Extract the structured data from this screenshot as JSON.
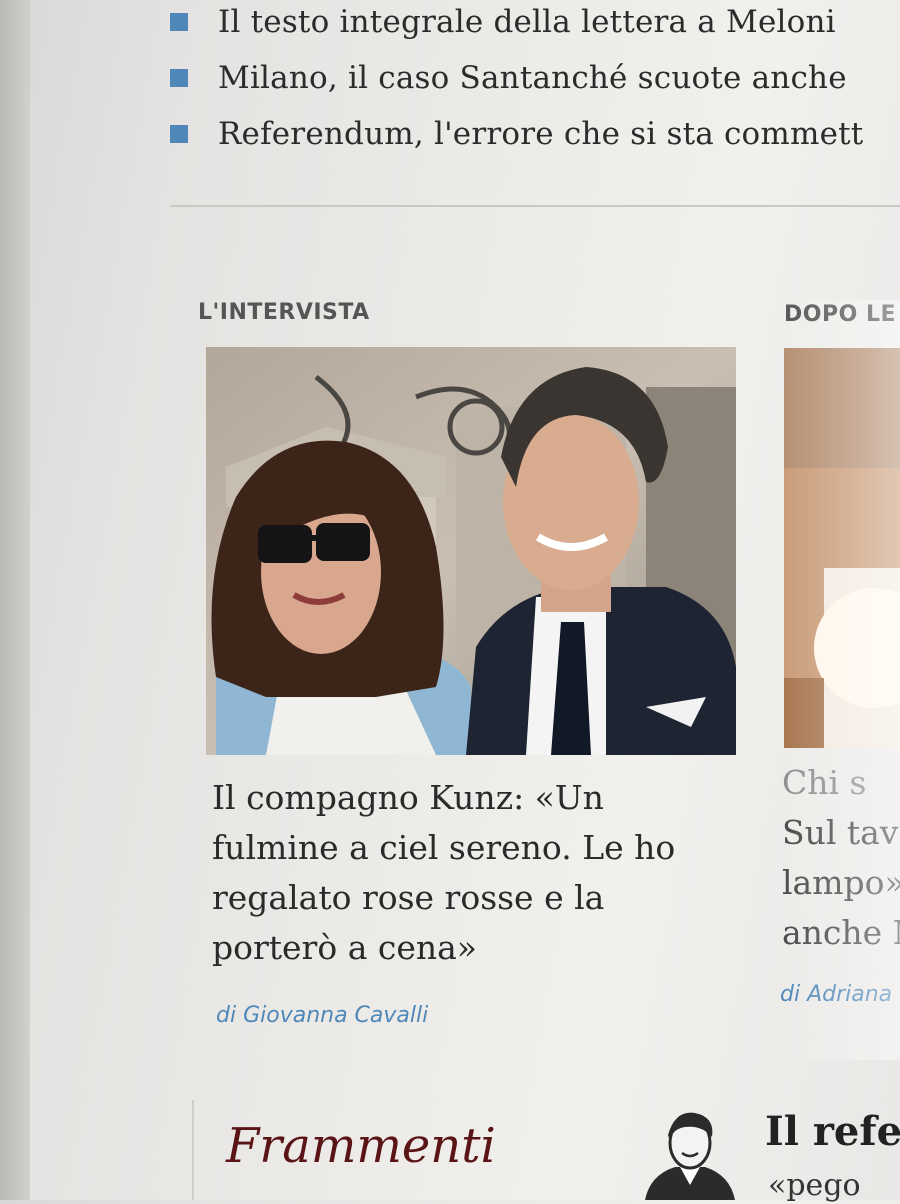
{
  "related_links": [
    {
      "label": "Il testo integrale della lettera a Meloni"
    },
    {
      "label": "Milano, il caso Santanché scuote anche"
    },
    {
      "label": "Referendum, l'errore che si sta commett"
    }
  ],
  "main_card": {
    "section": "L'INTERVISTA",
    "headline_lines": [
      "Il compagno Kunz: «Un",
      "fulmine a ciel sereno. Le ho",
      "regalato rose rosse e la",
      "porterò a cena»"
    ],
    "author": "di Giovanna Cavalli"
  },
  "side_card": {
    "section": "DOPO LE D",
    "headline_lines": [
      "Chi s",
      "Sul tav",
      "lampo»",
      "anche M"
    ],
    "author": "di Adriana"
  },
  "bottom": {
    "frammenti": "Frammenti",
    "opinion_title": "Il refe",
    "opinion_sub": "«pego"
  },
  "colors": {
    "bullet": "#4f87b8",
    "author_link": "#4f88b9",
    "frammenti": "#5a1416"
  }
}
